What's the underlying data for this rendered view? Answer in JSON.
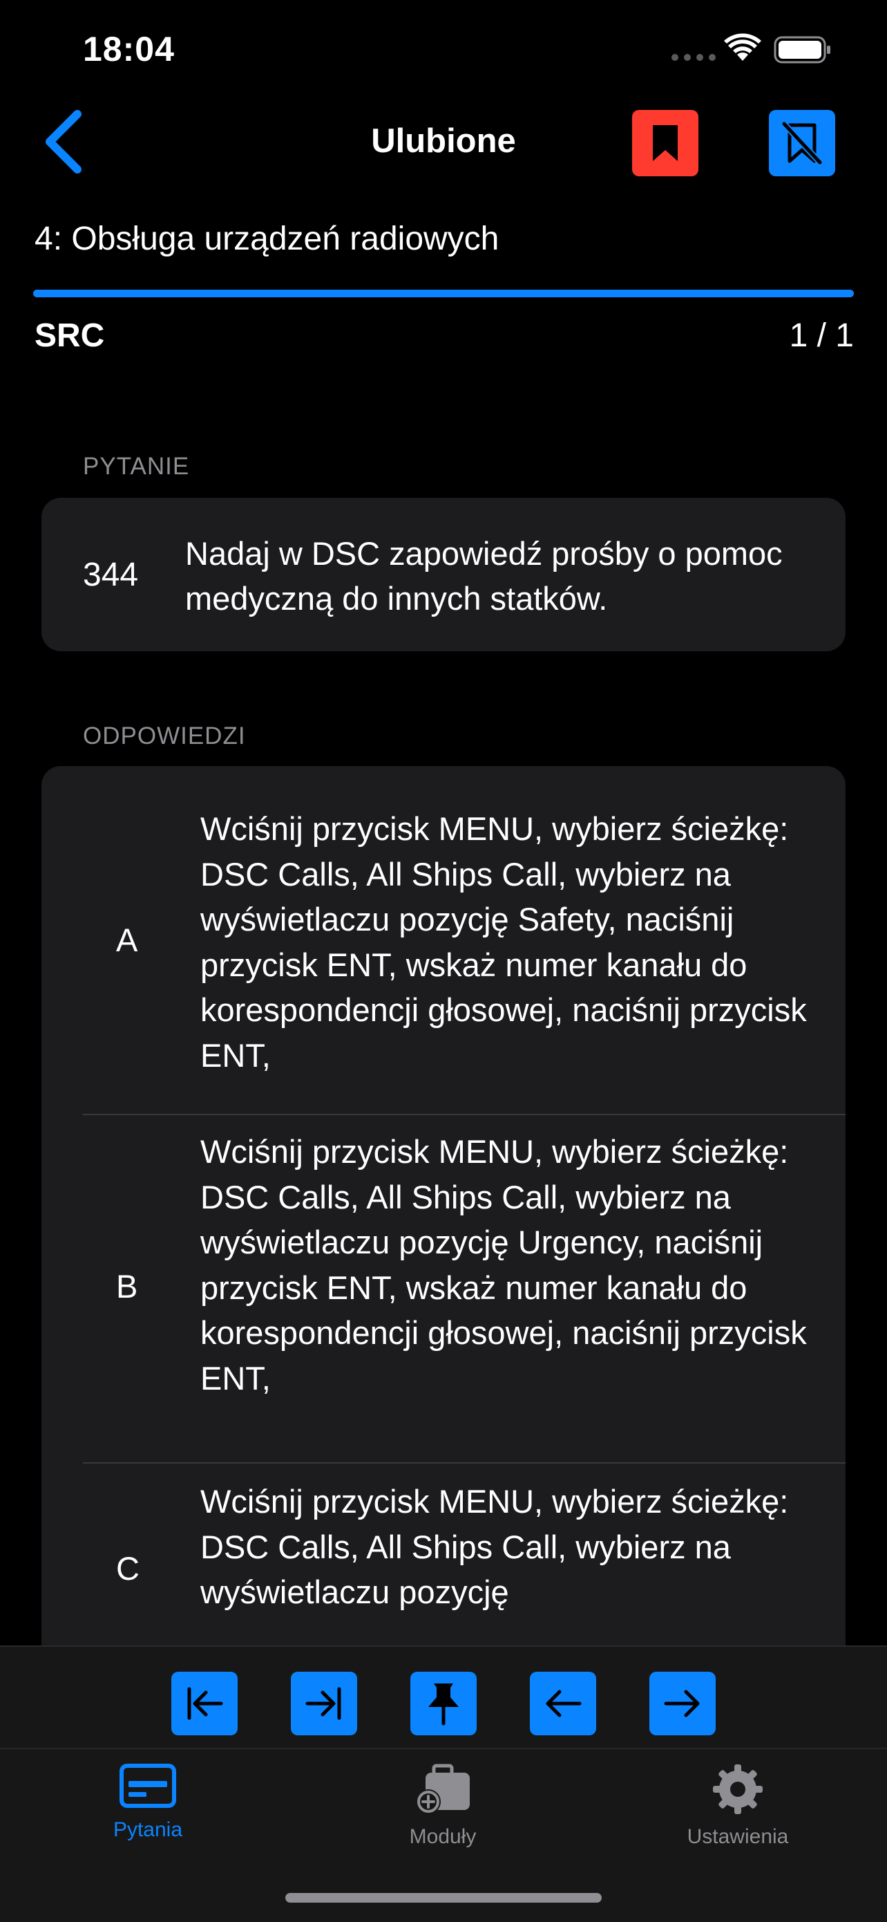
{
  "status_bar": {
    "time": "18:04"
  },
  "nav": {
    "title": "Ulubione"
  },
  "module": {
    "title": "4:  Obsługa urządzeń radiowych",
    "progress": 1.0
  },
  "category": {
    "name": "SRC",
    "counter": "1 / 1"
  },
  "question": {
    "header": "PYTANIE",
    "number": "344",
    "text": "Nadaj w DSC zapowiedź prośby o pomoc medyczną do innych statków."
  },
  "answers": {
    "header": "ODPOWIEDZI",
    "items": [
      {
        "letter": "A",
        "text": "Wciśnij przycisk MENU, wybierz ścieżkę: DSC Calls, All Ships Call, wybierz na wyświetlaczu pozycję Safety, naciśnij przycisk ENT, wskaż numer kanału do korespondencji głosowej, naciśnij przycisk ENT,"
      },
      {
        "letter": "B",
        "text": "Wciśnij przycisk MENU, wybierz ścieżkę: DSC Calls, All Ships Call, wybierz na wyświetlaczu pozycję Urgency, naciśnij przycisk ENT, wskaż numer kanału do korespondencji głosowej, naciśnij przycisk ENT,"
      },
      {
        "letter": "C",
        "text": "Wciśnij przycisk MENU, wybierz ścieżkę: DSC Calls, All Ships Call, wybierz na wyświetlaczu pozycję"
      }
    ]
  },
  "tabs": [
    {
      "label": "Pytania",
      "icon": "card-icon",
      "active": true
    },
    {
      "label": "Moduły",
      "icon": "briefcase-plus-icon",
      "active": false
    },
    {
      "label": "Ustawienia",
      "icon": "gear-icon",
      "active": false
    }
  ],
  "colors": {
    "accent": "#0a84ff",
    "bookmark": "#ff3b30",
    "card": "#1c1c1e",
    "background": "#000000"
  }
}
